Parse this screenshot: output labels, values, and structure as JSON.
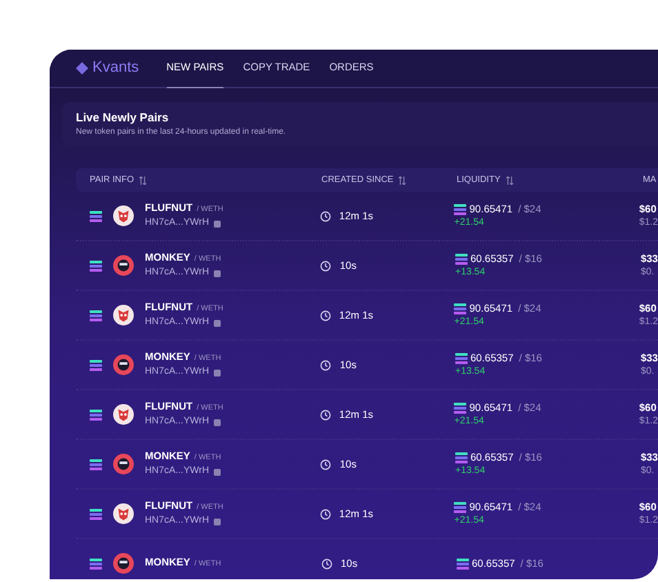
{
  "brand": "Kvants",
  "nav": [
    {
      "label": "NEW PAIRS",
      "selected": true
    },
    {
      "label": "COPY TRADE",
      "selected": false
    },
    {
      "label": "ORDERS",
      "selected": false
    }
  ],
  "section": {
    "title": "Live Newly Pairs",
    "subtitle": "New token pairs in the last 24-hours updated in real-time."
  },
  "columns": [
    {
      "label": "PAIR INFO",
      "sortable": true
    },
    {
      "label": "CREATED SINCE",
      "sortable": true
    },
    {
      "label": "LIQUIDITY",
      "sortable": true
    },
    {
      "label": "MA",
      "sortable": false
    }
  ],
  "rows": [
    {
      "token": "FLUFNUT",
      "kind": "dog",
      "quote": "/ WETH",
      "address": "HN7cA...YWrH",
      "created": "12m 1s",
      "liquidity": "90.65471",
      "liquidity_usd": "/ $24",
      "change": "+21.54",
      "market": "$60",
      "market_sub": "$1.2"
    },
    {
      "token": "MONKEY",
      "kind": "monkey",
      "quote": "/ WETH",
      "address": "HN7cA...YWrH",
      "created": "10s",
      "liquidity": "60.65357",
      "liquidity_usd": "/ $16",
      "change": "+13.54",
      "market": "$33",
      "market_sub": "$0."
    },
    {
      "token": "FLUFNUT",
      "kind": "dog",
      "quote": "/ WETH",
      "address": "HN7cA...YWrH",
      "created": "12m 1s",
      "liquidity": "90.65471",
      "liquidity_usd": "/ $24",
      "change": "+21.54",
      "market": "$60",
      "market_sub": "$1.2"
    },
    {
      "token": "MONKEY",
      "kind": "monkey",
      "quote": "/ WETH",
      "address": "HN7cA...YWrH",
      "created": "10s",
      "liquidity": "60.65357",
      "liquidity_usd": "/ $16",
      "change": "+13.54",
      "market": "$33",
      "market_sub": "$0."
    },
    {
      "token": "FLUFNUT",
      "kind": "dog",
      "quote": "/ WETH",
      "address": "HN7cA...YWrH",
      "created": "12m 1s",
      "liquidity": "90.65471",
      "liquidity_usd": "/ $24",
      "change": "+21.54",
      "market": "$60",
      "market_sub": "$1.2"
    },
    {
      "token": "MONKEY",
      "kind": "monkey",
      "quote": "/ WETH",
      "address": "HN7cA...YWrH",
      "created": "10s",
      "liquidity": "60.65357",
      "liquidity_usd": "/ $16",
      "change": "+13.54",
      "market": "$33",
      "market_sub": "$0."
    },
    {
      "token": "FLUFNUT",
      "kind": "dog",
      "quote": "/ WETH",
      "address": "HN7cA...YWrH",
      "created": "12m 1s",
      "liquidity": "90.65471",
      "liquidity_usd": "/ $24",
      "change": "+21.54",
      "market": "$60",
      "market_sub": "$1.2"
    },
    {
      "token": "MONKEY",
      "kind": "monkey",
      "quote": "/ WETH",
      "created": "10s",
      "liquidity": "60.65357",
      "liquidity_usd": "/ $16"
    }
  ]
}
